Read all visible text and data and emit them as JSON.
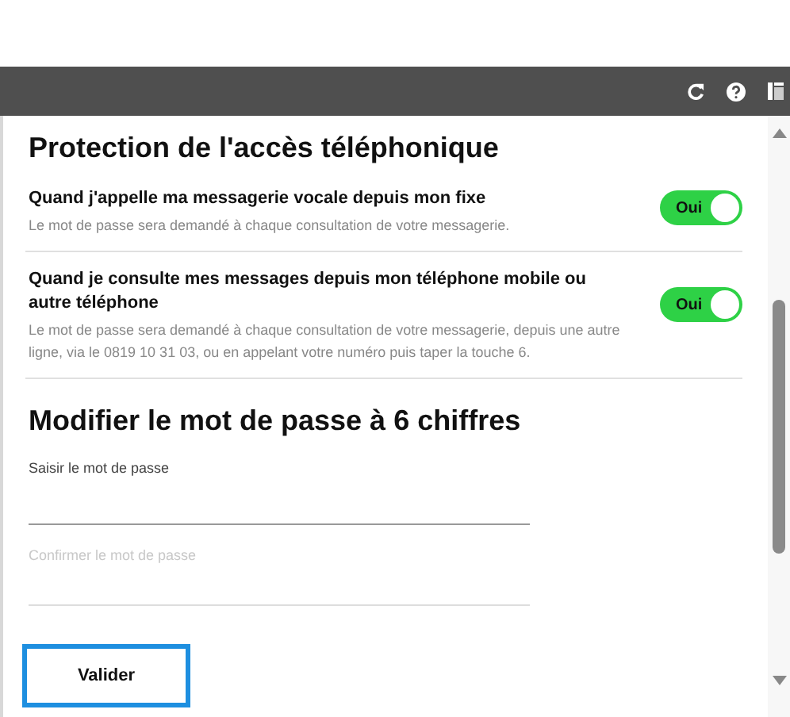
{
  "toolbar": {
    "icons": [
      {
        "kind": "refresh"
      },
      {
        "kind": "help"
      },
      {
        "kind": "panel"
      }
    ]
  },
  "protection": {
    "title": "Protection de l'accès téléphonique",
    "options": [
      {
        "title": "Quand j'appelle ma messagerie vocale depuis mon fixe",
        "description": "Le mot de passe sera demandé à chaque consultation de votre messagerie.",
        "on": true,
        "toggle_label": "Oui"
      },
      {
        "title": "Quand je consulte mes messages depuis mon téléphone mobile ou autre téléphone",
        "description": "Le mot de passe sera demandé à chaque consultation de votre messagerie, depuis une autre ligne, via le 0819 10 31 03, ou en appelant votre numéro puis taper la touche 6.",
        "on": true,
        "toggle_label": "Oui"
      }
    ]
  },
  "password": {
    "title": "Modifier le mot de passe à 6 chiffres",
    "fields": [
      {
        "label": "Saisir le mot de passe"
      },
      {
        "placeholder": "Confirmer le mot de passe"
      }
    ],
    "submit": {
      "label": "Valider",
      "focused": true
    }
  }
}
